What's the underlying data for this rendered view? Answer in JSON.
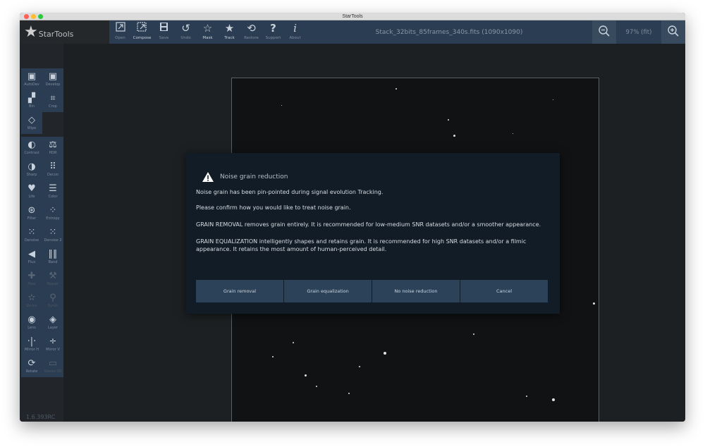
{
  "window": {
    "title": "StarTools"
  },
  "logo": {
    "text": "StarTools"
  },
  "toolbar": {
    "buttons": [
      {
        "label": "Open",
        "icon": "export-icon"
      },
      {
        "label": "Compose",
        "icon": "compose-icon"
      },
      {
        "label": "Save",
        "icon": "save-icon"
      },
      {
        "label": "Undo",
        "icon": "undo-icon"
      },
      {
        "label": "Mask",
        "icon": "mask-icon"
      },
      {
        "label": "Track",
        "icon": "track-icon"
      },
      {
        "label": "Restore",
        "icon": "restore-icon"
      },
      {
        "label": "Support",
        "icon": "question-icon"
      },
      {
        "label": "About",
        "icon": "info-icon"
      }
    ],
    "file_info": "Stack_32bits_85frames_340s.fits (1090x1090)",
    "zoom_level": "97% (fit)"
  },
  "modules": [
    {
      "label": "AutoDev",
      "icon": "autodev-icon"
    },
    {
      "label": "Develop",
      "icon": "develop-icon"
    },
    {
      "label": "Bin",
      "icon": "bin-icon"
    },
    {
      "label": "Crop",
      "icon": "crop-icon"
    },
    {
      "label": "Wipe",
      "icon": "wipe-icon"
    },
    {
      "label": "Contrast",
      "icon": "contrast-icon"
    },
    {
      "label": "HDR",
      "icon": "hdr-icon"
    },
    {
      "label": "Sharp",
      "icon": "sharp-icon"
    },
    {
      "label": "Decon",
      "icon": "decon-icon"
    },
    {
      "label": "Life",
      "icon": "heart-icon"
    },
    {
      "label": "Color",
      "icon": "color-icon"
    },
    {
      "label": "Filter",
      "icon": "filter-icon"
    },
    {
      "label": "Entropy",
      "icon": "entropy-icon"
    },
    {
      "label": "Denoise",
      "icon": "denoise-icon"
    },
    {
      "label": "Denoise 2",
      "icon": "denoise2-icon"
    },
    {
      "label": "Flux",
      "icon": "flux-icon"
    },
    {
      "label": "Band",
      "icon": "band-icon"
    },
    {
      "label": "Heal",
      "icon": "heal-icon"
    },
    {
      "label": "Repair",
      "icon": "repair-icon"
    },
    {
      "label": "Shrink",
      "icon": "shrink-icon"
    },
    {
      "label": "Synth",
      "icon": "synth-icon"
    },
    {
      "label": "Lens",
      "icon": "lens-icon"
    },
    {
      "label": "Layer",
      "icon": "layer-icon"
    },
    {
      "label": "Mirror H",
      "icon": "mirror-h-icon"
    },
    {
      "label": "Mirror V",
      "icon": "mirror-v-icon"
    },
    {
      "label": "Rotate",
      "icon": "rotate-icon"
    },
    {
      "label": "Stereo 3D",
      "icon": "stereo-icon"
    }
  ],
  "version": "1.6.393RC",
  "dialog": {
    "title": "Noise grain reduction",
    "lines": [
      "Noise grain has been pin-pointed during signal evolution Tracking.",
      "Please confirm how you would like to treat noise grain.",
      "GRAIN REMOVAL removes grain entirely. It is recommended for low-medium SNR datasets and/or a smoother appearance.",
      "GRAIN EQUALIZATION intelligently shapes and retains grain. It is recommended for high SNR datasets and/or a filmic appearance. It retains the most amount of human-perceived detail."
    ],
    "buttons": [
      "Grain removal",
      "Grain equalization",
      "No noise reduction",
      "Cancel"
    ]
  },
  "colors": {
    "toolbar_bg": "#2b3d52",
    "dialog_bg": "#121c27",
    "button_bg": "#2b4258"
  }
}
